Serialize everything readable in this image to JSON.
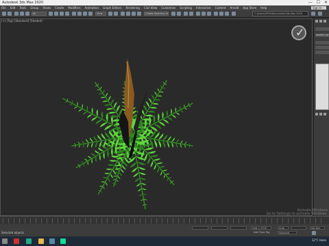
{
  "window": {
    "title": "Autodesk 3ds Max 2020",
    "controls": [
      "—",
      "☐",
      "✕"
    ]
  },
  "menu": {
    "items": [
      "File",
      "Edit",
      "Tools",
      "Group",
      "Views",
      "Create",
      "Modifiers",
      "Animation",
      "Graph Editors",
      "Rendering",
      "Civil View",
      "Customize",
      "Scripting",
      "Interactive",
      "Content",
      "Arnold",
      "App Store",
      "Help"
    ],
    "sign_in": "Sign In"
  },
  "toolbar": {
    "filter": "All",
    "view": "View",
    "selection_set": "Create Selection Se",
    "project_path": "C:\\Users\\GPU\\Documents\\3ds Max 2020"
  },
  "viewport": {
    "label": "[+] [Top] [Standard] [Shaded]"
  },
  "command_panel": {
    "name_field": "Modifier List",
    "rows": [
      "",
      "",
      "",
      ""
    ]
  },
  "status": {
    "selection": "Selected objects",
    "x_field": "",
    "y_field": "",
    "z_field": "",
    "grid": "Grid = 0'10\"",
    "add_time_tag": "Add Time Tag",
    "auto": "Auto",
    "set_key": "Set Key",
    "selected": "Selected"
  },
  "activate": {
    "line1": "Activate Windows",
    "line2": "Go to Settings to activate Windows."
  },
  "tray": {
    "weather": "32°C Haze"
  },
  "colors": {
    "frond_light": "#5ed63d",
    "frond_dark": "#2f8a1f",
    "spike_brown": "#8a5a20",
    "viewport_bg": "#2a2a2a"
  }
}
